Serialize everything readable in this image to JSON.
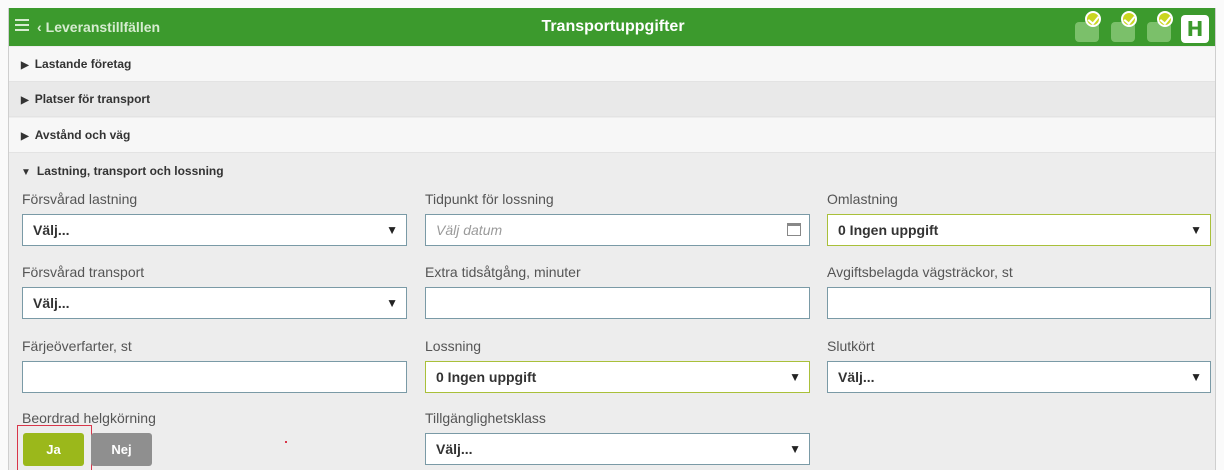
{
  "header": {
    "back_label": "Leveranstillfällen",
    "title": "Transportuppgifter",
    "icons": [
      "eye-icon",
      "document-icon",
      "truck-icon",
      "h-icon"
    ],
    "h_letter": "H",
    "accent_color": "#3c9a2d"
  },
  "sections": [
    {
      "label": "Lastande företag",
      "expanded": false
    },
    {
      "label": "Platser för transport",
      "expanded": false
    },
    {
      "label": "Avstånd och väg",
      "expanded": false
    },
    {
      "label": "Lastning, transport och lossning",
      "expanded": true
    }
  ],
  "arrows": {
    "collapsed": "▶",
    "expanded": "▼",
    "select": "▼"
  },
  "form": {
    "forsvarad_lastning": {
      "label": "Försvårad lastning",
      "value": "Välj..."
    },
    "tidpunkt_lossning": {
      "label": "Tidpunkt för lossning",
      "placeholder": "Välj datum"
    },
    "omlastning": {
      "label": "Omlastning",
      "value": "0 Ingen uppgift"
    },
    "forsvarad_transport": {
      "label": "Försvårad transport",
      "value": "Välj..."
    },
    "extra_tid": {
      "label": "Extra tidsåtgång, minuter",
      "value": ""
    },
    "avgiftsbelagda": {
      "label": "Avgiftsbelagda vägsträckor, st",
      "value": ""
    },
    "farjeoverfarter": {
      "label": "Färjeöverfarter, st",
      "value": ""
    },
    "lossning": {
      "label": "Lossning",
      "value": "0 Ingen uppgift"
    },
    "slutkort": {
      "label": "Slutkört",
      "value": "Välj..."
    },
    "beordrad_helgkorning": {
      "label": "Beordrad helgkörning",
      "yes": "Ja",
      "no": "Nej",
      "selected": "Ja"
    },
    "tillganglighetsklass": {
      "label": "Tillgänglighetsklass",
      "value": "Välj..."
    }
  }
}
